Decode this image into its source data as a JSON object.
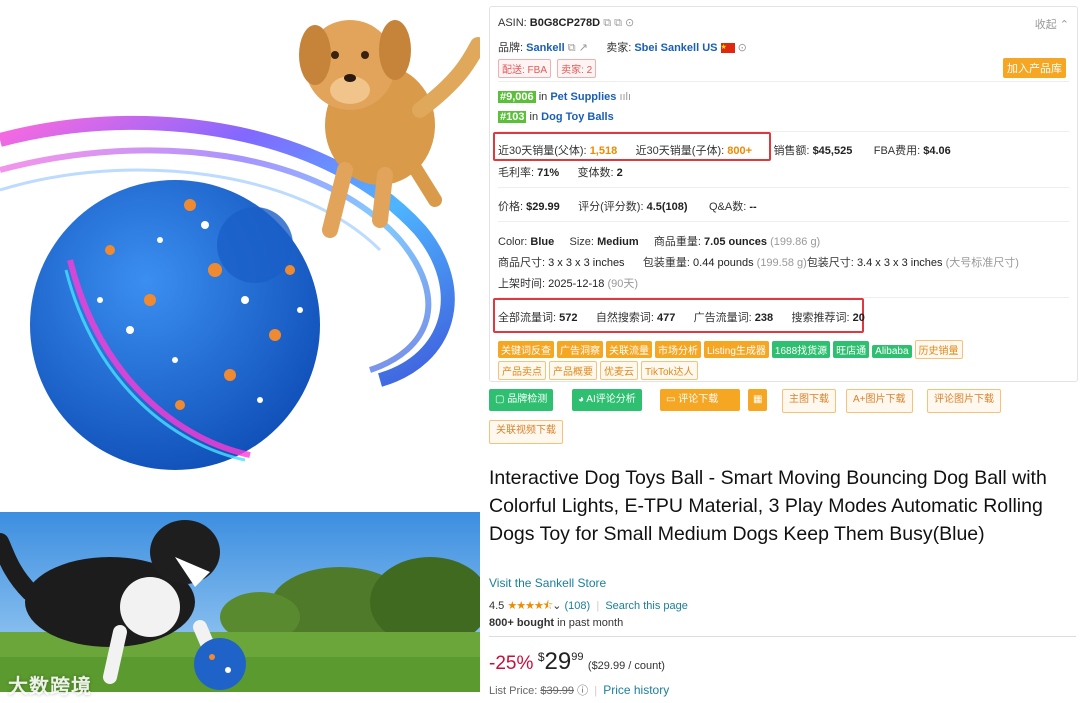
{
  "panel": {
    "asin_label": "ASIN:",
    "asin": "B0G8CP278D",
    "collapse": "收起",
    "brand_label": "品牌:",
    "brand": "Sankell",
    "seller_label": "卖家:",
    "seller": "Sbei Sankell US",
    "delivery_fba": "配送: FBA",
    "seller_count": "卖家: 2",
    "add_library": "加入产品库",
    "rank1": "#9,006",
    "rank1_in": "in",
    "rank1_cat": "Pet Supplies",
    "rank2": "#103",
    "rank2_in": "in",
    "rank2_cat": "Dog Toy Balls",
    "sales_parent_label": "近30天销量(父体):",
    "sales_parent": "1,518",
    "sales_child_label": "近30天销量(子体):",
    "sales_child": "800+",
    "revenue_label": "销售额:",
    "revenue": "$45,525",
    "fba_fee_label": "FBA费用:",
    "fba_fee": "$4.06",
    "margin_label": "毛利率:",
    "margin": "71%",
    "variants_label": "变体数:",
    "variants": "2",
    "price_label": "价格:",
    "price": "$29.99",
    "rating_label": "评分(评分数):",
    "rating": "4.5(108)",
    "qa_label": "Q&A数:",
    "qa": "--",
    "color_label": "Color:",
    "color": "Blue",
    "size_label": "Size:",
    "size": "Medium",
    "weight_label": "商品重量:",
    "weight": "7.05 ounces",
    "weight_g": "(199.86 g)",
    "dims_label": "商品尺寸:",
    "dims": "3 x 3 x 3 inches",
    "pkg_weight_label": "包装重量:",
    "pkg_weight": "0.44 pounds",
    "pkg_weight_g": "(199.58 g)",
    "pkg_dims_label": "包装尺寸:",
    "pkg_dims": "3.4 x 3 x 3 inches",
    "pkg_dims_note": "(大号标准尺寸)",
    "listed_label": "上架时间:",
    "listed": "2025-12-18",
    "listed_days": "(90天)",
    "kw_all_label": "全部流量词:",
    "kw_all": "572",
    "kw_organic_label": "自然搜索词:",
    "kw_organic": "477",
    "kw_ad_label": "广告流量词:",
    "kw_ad": "238",
    "kw_rec_label": "搜索推荐词:",
    "kw_rec": "20",
    "tags_row1": [
      "关键词反查",
      "广告洞察",
      "关联流量",
      "市场分析",
      "Listing生成器"
    ],
    "tags_row1_green": [
      "1688找货源",
      "旺店通",
      "Alibaba"
    ],
    "tag_history": "历史销量",
    "tags_row2": [
      "产品卖点",
      "产品概要",
      "优麦云",
      "TikTok达人"
    ]
  },
  "buttons": {
    "brand_check": "品牌检测",
    "ai_review": "AI评论分析",
    "review_download": "评论下载",
    "calc": "▦",
    "main_img": "主图下载",
    "aplus_img": "A+图片下载",
    "review_img": "评论图片下载",
    "related_video": "关联视频下载"
  },
  "product": {
    "title": "Interactive Dog Toys Ball - Smart Moving Bouncing Dog Ball with Colorful Lights, E-TPU Material, 3 Play Modes Automatic Rolling Dogs Toy for Small Medium Dogs Keep Them Busy(Blue)",
    "store": "Visit the Sankell Store",
    "rating": "4.5",
    "stars": "★★★★⯪",
    "rating_count": "(108)",
    "search_page": "Search this page",
    "bought_bold": "800+ bought",
    "bought_rest": " in past month",
    "discount": "-25%",
    "currency": "$",
    "price_whole": "29",
    "price_cents": "99",
    "unit_price": "($29.99 / count)",
    "list_price_label": "List Price:",
    "list_price": "$39.99",
    "price_history": "Price history"
  },
  "watermark": "大数跨境",
  "colors": {
    "accent_orange": "#f08a00",
    "link_blue": "#1a5fb4",
    "highlight_red": "#e0383e",
    "discount_red": "#cc0c39"
  }
}
